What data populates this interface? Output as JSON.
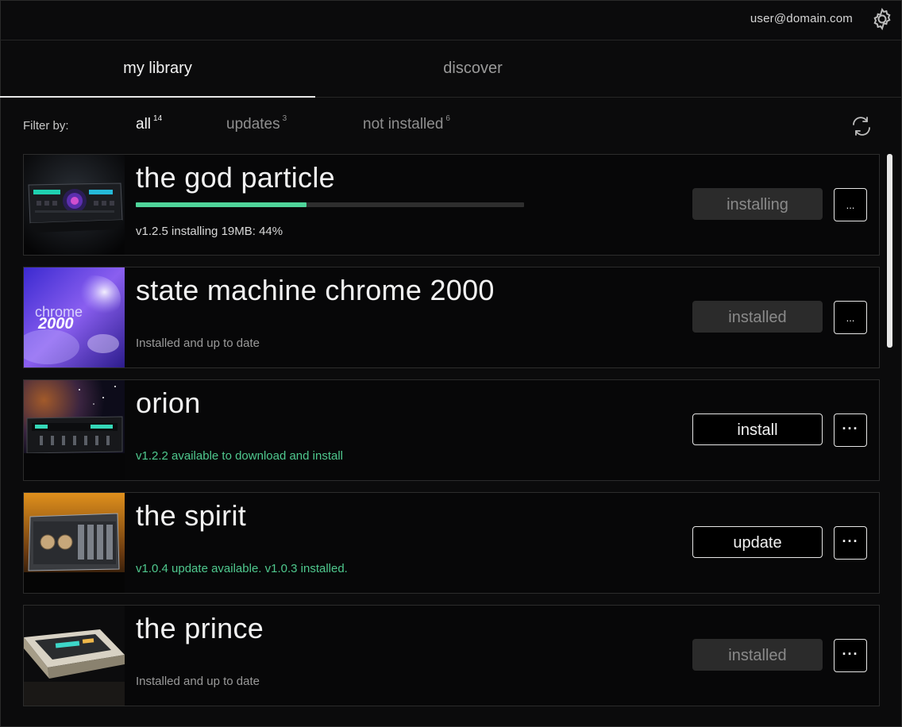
{
  "header": {
    "user_email": "user@domain.com"
  },
  "tabs": [
    {
      "label": "my library",
      "active": true
    },
    {
      "label": "discover",
      "active": false
    }
  ],
  "filter": {
    "label": "Filter by:",
    "options": [
      {
        "label": "all",
        "count": "14",
        "active": true
      },
      {
        "label": "updates",
        "count": "3",
        "active": false
      },
      {
        "label": "not installed",
        "count": "6",
        "active": false
      }
    ]
  },
  "colors": {
    "accent_green": "#4fd49a",
    "background": "#0b0b0c"
  },
  "items": [
    {
      "title": "the god particle",
      "status": "v1.2.5 installing  19MB: 44%",
      "button": "installing",
      "button_state": "disabled",
      "more": "...",
      "progress_percent": 44
    },
    {
      "title": "state machine chrome 2000",
      "status": "Installed and up to date",
      "button": "installed",
      "button_state": "disabled",
      "more": "...",
      "thumb_text_1": "chrome",
      "thumb_text_2": "2000"
    },
    {
      "title": "orion",
      "status": "v1.2.2 available to download and install",
      "button": "install",
      "button_state": "active",
      "more": "···"
    },
    {
      "title": "the spirit",
      "status": "v1.0.4 update available. v1.0.3 installed.",
      "button": "update",
      "button_state": "active",
      "more": "···"
    },
    {
      "title": "the prince",
      "status": "Installed and up to date",
      "button": "installed",
      "button_state": "disabled",
      "more": "···"
    }
  ]
}
